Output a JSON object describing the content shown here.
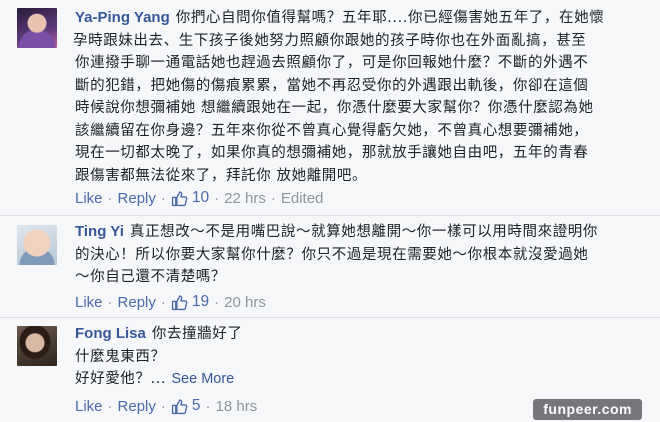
{
  "comments": [
    {
      "author": "Ya-Ping Yang",
      "lines": [
        "你捫心自問你值得幫嗎？五年耶....你已經傷害她五年了，在她懷",
        "孕時跟妹出去、生下孩子後她努力照顧你跟她的孩子時你也在外面亂搞，甚至",
        "你連撥手聊一通電話她也趕過去照顧你了，可是你回報她什麼？不斷的外遇不",
        "斷的犯錯，把她傷的傷痕累累，當她不再忍受你的外遇跟出軌後，你卻在這個",
        "時候說你想彌補她 想繼續跟她在一起，你憑什麼要大家幫你？你憑什麼認為她",
        "該繼續留在你身邊？五年來你從不曾真心覺得虧欠她，不曾真心想要彌補她，",
        "現在一切都太晚了，如果你真的想彌補她，那就放手讓她自由吧，五年的青春",
        "跟傷害都無法從來了，拜託你 放她離開吧。"
      ],
      "like_label": "Like",
      "reply_label": "Reply",
      "like_count": "10",
      "time": "22 hrs",
      "edited": "Edited"
    },
    {
      "author": "Ting Yi",
      "lines": [
        "真正想改～不是用嘴巴說～就算她想離開～你一樣可以用時間來證明你",
        "的決心！所以你要大家幫你什麼？你只不過是現在需要她～你根本就沒愛過她",
        "～你自己還不清楚嗎？"
      ],
      "like_label": "Like",
      "reply_label": "Reply",
      "like_count": "19",
      "time": "20 hrs"
    },
    {
      "author": "Fong Lisa",
      "lines": [
        "你去撞牆好了",
        "什麼鬼東西？",
        "好好愛他？..."
      ],
      "see_more": "See More",
      "like_label": "Like",
      "reply_label": "Reply",
      "like_count": "5",
      "time": "18 hrs"
    }
  ],
  "icons": {
    "like": "thumbs-up-icon"
  },
  "colors": {
    "link": "#365899",
    "meta": "#90949c",
    "background": "#f6f7f9"
  },
  "watermark": "funpeer.com"
}
